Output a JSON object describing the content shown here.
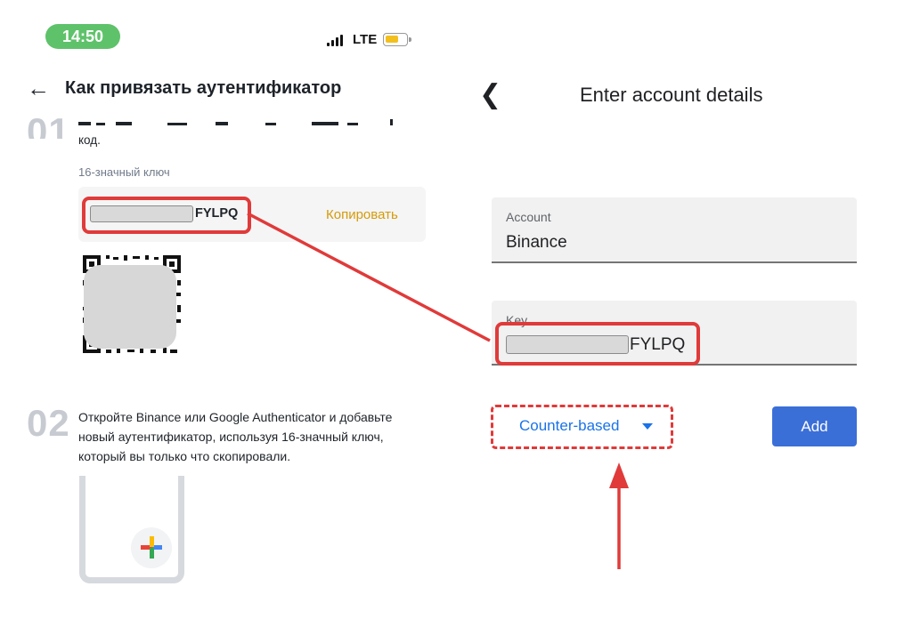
{
  "status_bar": {
    "time": "14:50",
    "network": "LTE"
  },
  "left_page": {
    "title": "Как привязать аутентификатор",
    "step1": {
      "number": "01",
      "text_tail": "код.",
      "key_label": "16-значный ключ",
      "key_suffix": "FYLPQ",
      "copy_label": "Копировать"
    },
    "step2": {
      "number": "02",
      "text": "Откройте Binance или Google Authenticator и добавьте новый аутентификатор, используя 16-значный ключ, который вы только что скопировали."
    }
  },
  "right_page": {
    "title": "Enter account details",
    "account_field": {
      "label": "Account",
      "value": "Binance"
    },
    "key_field": {
      "label": "Key",
      "value_suffix": "FYLPQ"
    },
    "counter_dropdown": {
      "label": "Counter-based"
    },
    "add_label": "Add"
  },
  "colors": {
    "annotation_red": "#e03a3a",
    "binance_gold": "#d49b0a",
    "google_blue": "#1a73e8",
    "add_button": "#3b6fd8",
    "time_pill": "#5ec26a"
  }
}
